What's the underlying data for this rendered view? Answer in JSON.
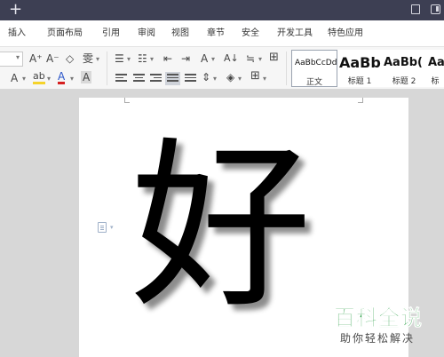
{
  "titlebar": {
    "new_tab_glyph": "+"
  },
  "menu": {
    "items": [
      "插入",
      "页面布局",
      "引用",
      "审阅",
      "视图",
      "章节",
      "安全",
      "开发工具",
      "特色应用"
    ]
  },
  "ribbon": {
    "font_grow": "A⁺",
    "font_shrink": "A⁻",
    "clear_format": "◇",
    "phonetic": "雯",
    "text_effect": "A",
    "highlight": "ab",
    "font_color": "A",
    "char_shading": "A",
    "char_scale": "A",
    "sort": "A↓",
    "styles": [
      {
        "sample": "AaBbCcDd",
        "name": "正文"
      },
      {
        "sample": "AaBb",
        "name": "标题 1"
      },
      {
        "sample": "AaBb(",
        "name": "标题 2"
      },
      {
        "sample": "Aa",
        "name": "标"
      }
    ]
  },
  "document": {
    "text": "好"
  },
  "watermark": {
    "title": "百科全说",
    "subtitle": "助你轻松解决"
  },
  "colors": {
    "titlebar": "#3d3f53",
    "watermark_green": "#1f9a3c",
    "highlight_yellow": "#f5d32b",
    "font_color_red": "#d62020",
    "font_color_blue": "#2a55c9"
  }
}
